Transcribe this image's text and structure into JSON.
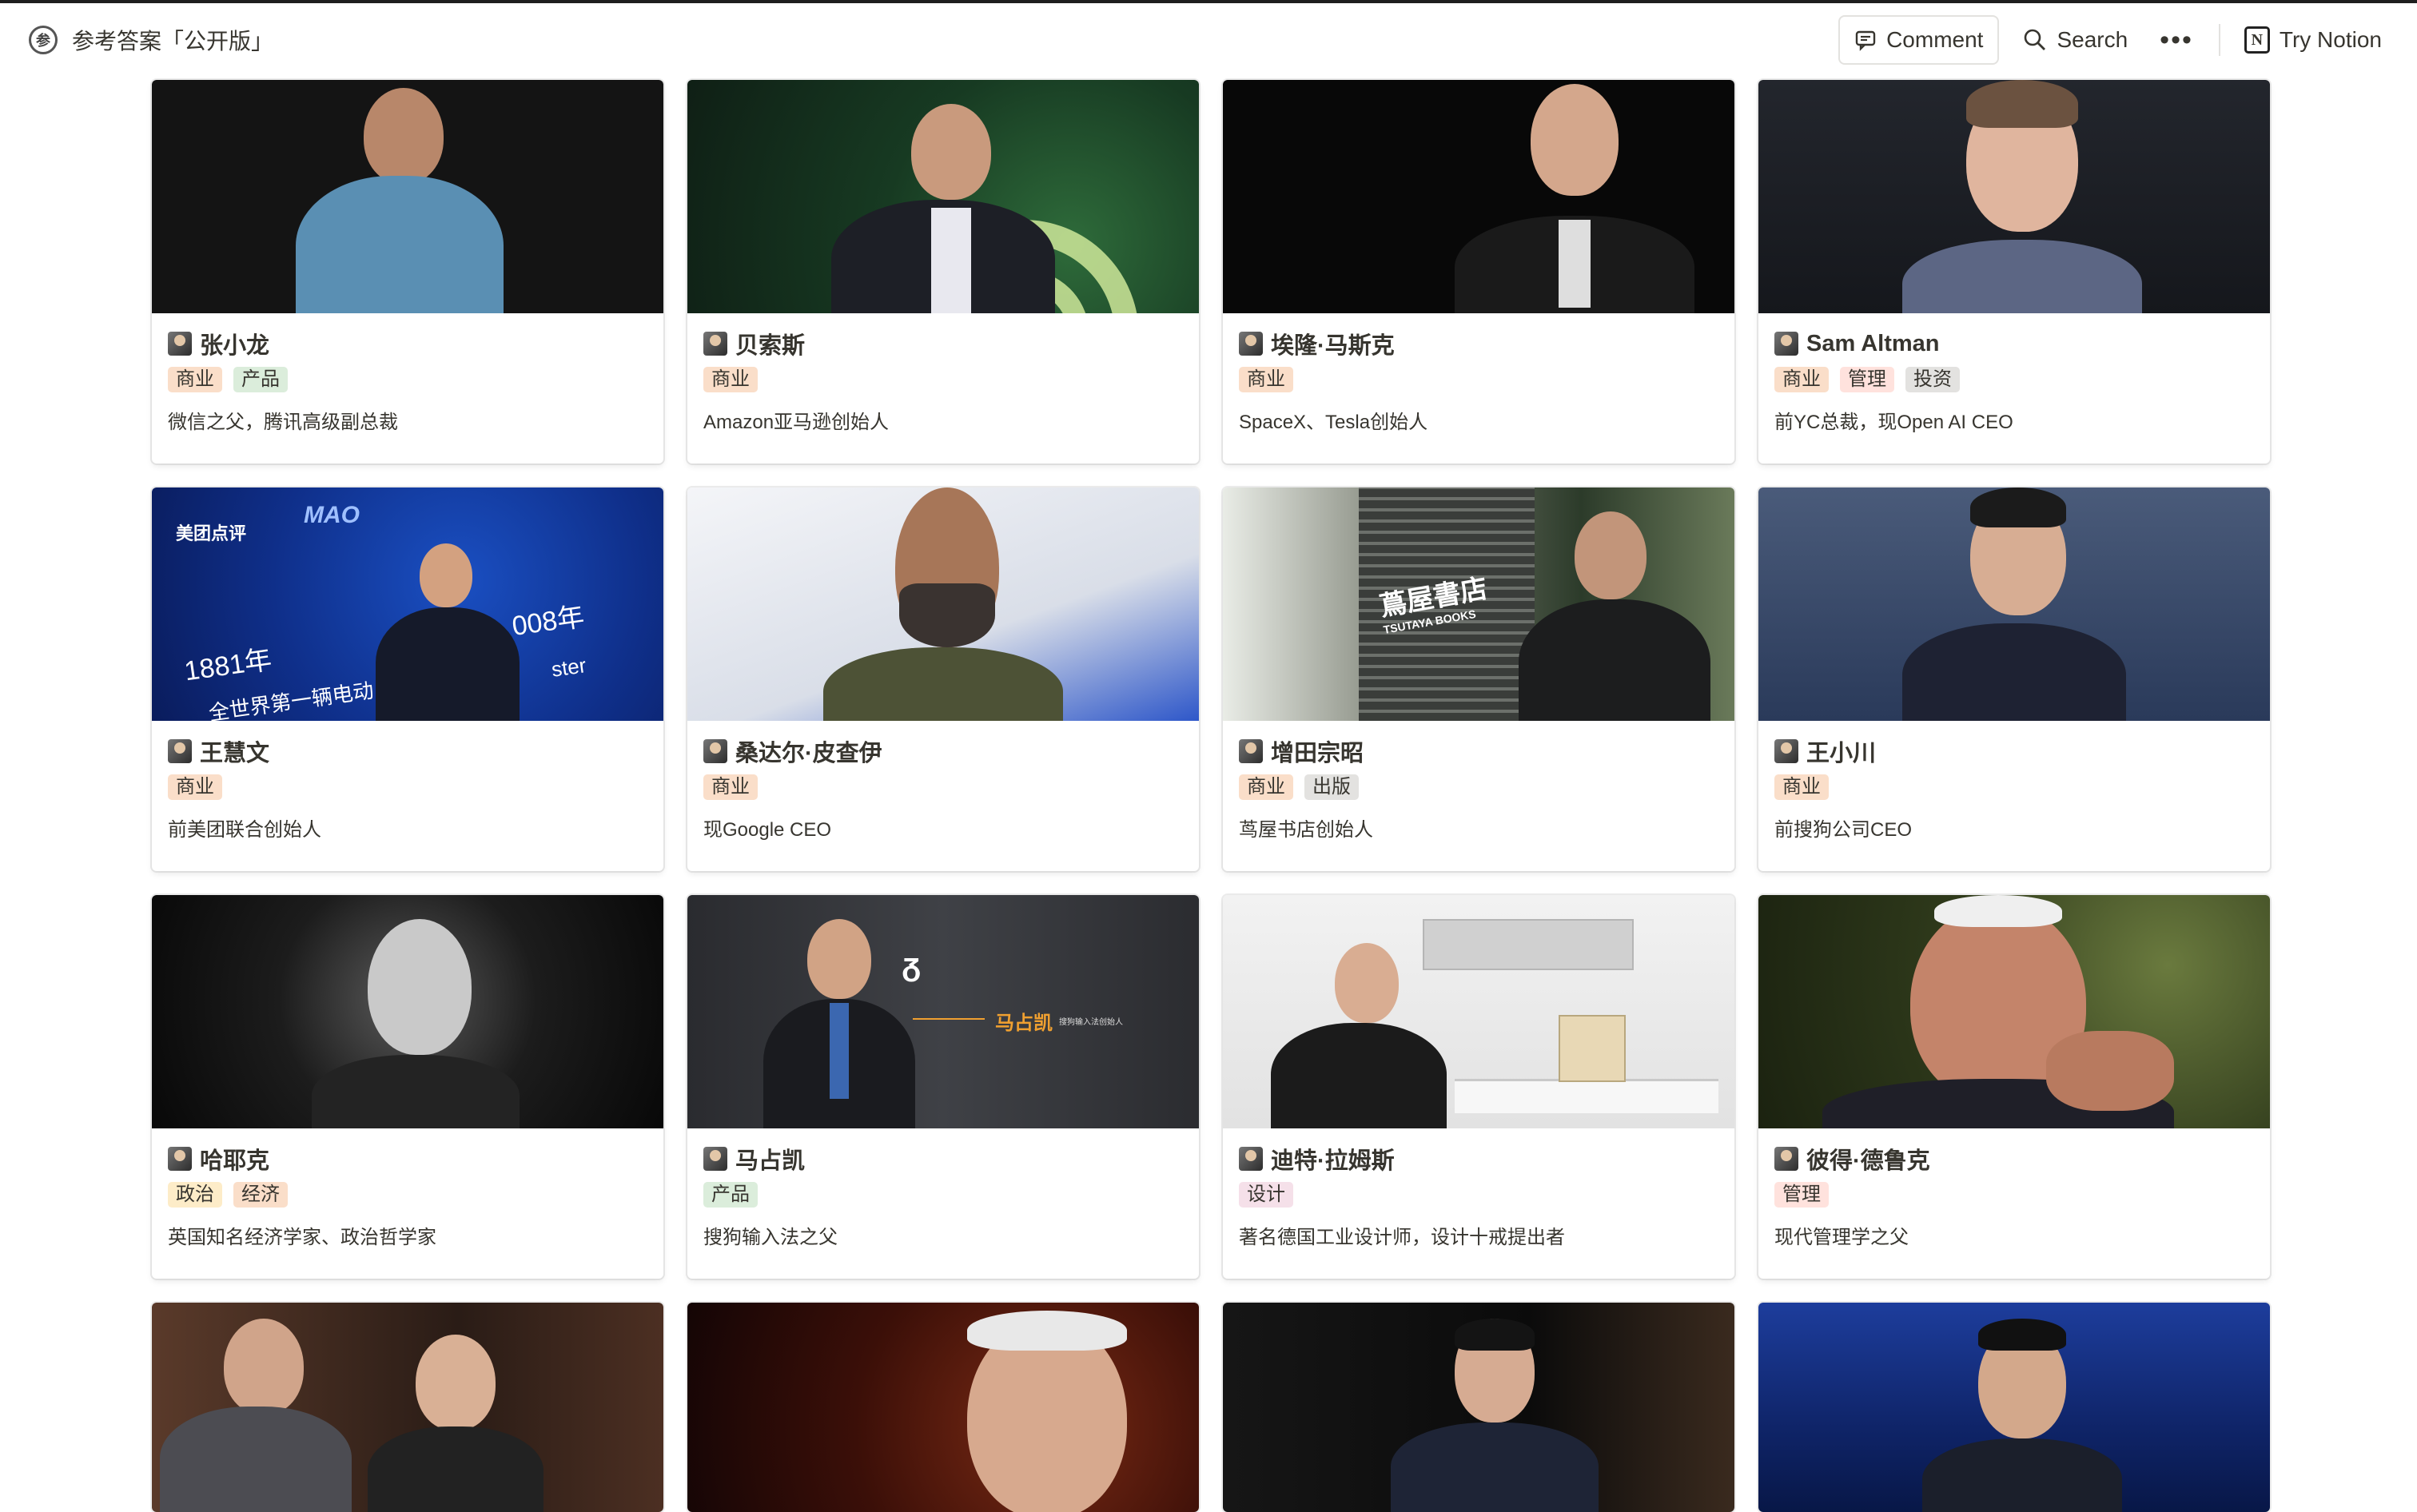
{
  "topbar": {
    "icon": "参",
    "title": "参考答案「公开版」",
    "comment_label": "Comment",
    "search_label": "Search",
    "more_label": "•••",
    "try_label": "Try Notion"
  },
  "colors": {
    "tag_商业": "#fadec9",
    "tag_产品": "#dbeddb",
    "tag_管理": "#ffe2dd",
    "tag_投资": "#e3e2e0",
    "tag_出版": "#e3e2e0",
    "tag_政治": "#fdecc8",
    "tag_经济": "#fadec9",
    "tag_设计": "#f5e0e9"
  },
  "cards": [
    {
      "name": "张小龙",
      "tags": [
        "商业",
        "产品"
      ],
      "desc": "微信之父，腾讯高级副总裁"
    },
    {
      "name": "贝索斯",
      "tags": [
        "商业"
      ],
      "desc": "Amazon亚马逊创始人"
    },
    {
      "name": "埃隆·马斯克",
      "tags": [
        "商业"
      ],
      "desc": "SpaceX、Tesla创始人"
    },
    {
      "name": "Sam Altman",
      "tags": [
        "商业",
        "管理",
        "投资"
      ],
      "desc": "前YC总裁，现Open AI CEO"
    },
    {
      "name": "王慧文",
      "tags": [
        "商业"
      ],
      "desc": "前美团联合创始人"
    },
    {
      "name": "桑达尔·皮查伊",
      "tags": [
        "商业"
      ],
      "desc": "现Google CEO"
    },
    {
      "name": "增田宗昭",
      "tags": [
        "商业",
        "出版"
      ],
      "desc": "茑屋书店创始人"
    },
    {
      "name": "王小川",
      "tags": [
        "商业"
      ],
      "desc": "前搜狗公司CEO"
    },
    {
      "name": "哈耶克",
      "tags": [
        "政治",
        "经济"
      ],
      "desc": "英国知名经济学家、政治哲学家"
    },
    {
      "name": "马占凯",
      "tags": [
        "产品"
      ],
      "desc": "搜狗输入法之父"
    },
    {
      "name": "迪特·拉姆斯",
      "tags": [
        "设计"
      ],
      "desc": "著名德国工业设计师，设计十戒提出者"
    },
    {
      "name": "彼得·德鲁克",
      "tags": [
        "管理"
      ],
      "desc": "现代管理学之父"
    }
  ],
  "cover_texts": {
    "meituan_brand": "美团点评",
    "meituan_logo": "MAO",
    "meituan_year1": "1881年",
    "meituan_year2": "008年",
    "meituan_line": "全世界第一辆电动",
    "meituan_word": "ster",
    "tsutaya_sign": "蔦屋書店",
    "tsutaya_sub": "TSUTAYA BOOKS",
    "ma_logo": "ᵹ",
    "ma_name": "马占凯",
    "ma_sub": "搜狗输入法创始人"
  }
}
